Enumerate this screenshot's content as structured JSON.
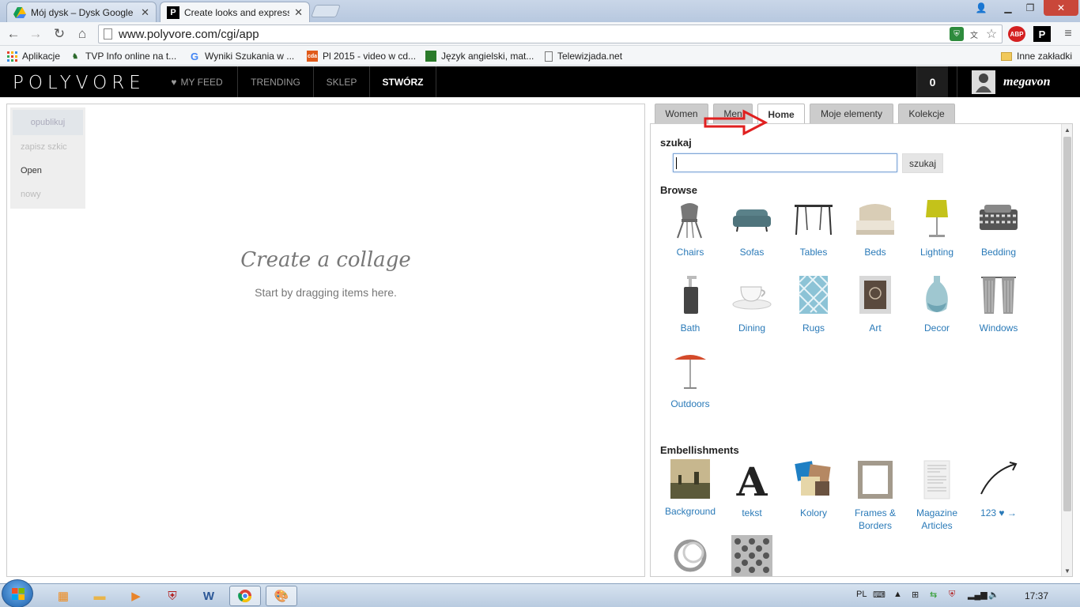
{
  "browser": {
    "tabs": [
      {
        "title": "Mój dysk – Dysk Google",
        "icon": "google-drive-icon"
      },
      {
        "title": "Create looks and express y",
        "icon": "polyvore-p-icon"
      }
    ],
    "url": "www.polyvore.com/cgi/app",
    "bookmarks": [
      {
        "label": "Aplikacje",
        "icon": "apps-grid-icon"
      },
      {
        "label": "TVP Info online na t...",
        "icon": "tvp-info-icon"
      },
      {
        "label": "Wyniki Szukania w ...",
        "icon": "google-g-icon"
      },
      {
        "label": "Pl 2015 - video w cd...",
        "icon": "cda-icon"
      },
      {
        "label": "Język angielski, mat...",
        "icon": "book-icon"
      },
      {
        "label": "Telewizjada.net",
        "icon": "page-icon"
      },
      {
        "label": "Inne zakładki",
        "icon": "folder-icon"
      }
    ],
    "ext_abp": "ABP",
    "ext_p": "P"
  },
  "polyvore": {
    "logo": "POLYVORE",
    "nav": [
      {
        "label": "MY FEED"
      },
      {
        "label": "TRENDING"
      },
      {
        "label": "SKLEP"
      },
      {
        "label": "STWÓRZ"
      }
    ],
    "notification_count": "0",
    "username": "megavon"
  },
  "canvas": {
    "menu": {
      "publish": "opublikuj",
      "save_draft": "zapisz szkic",
      "open": "Open",
      "new": "nowy"
    },
    "title": "Create a collage",
    "subtitle": "Start by dragging items here."
  },
  "panel": {
    "tabs": [
      "Women",
      "Men",
      "Home",
      "Moje elementy",
      "Kolekcje"
    ],
    "active_tab": "Home",
    "search_label": "szukaj",
    "search_value": "",
    "search_button": "szukaj",
    "browse_label": "Browse",
    "browse": [
      {
        "label": "Chairs",
        "icon": "chair-icon"
      },
      {
        "label": "Sofas",
        "icon": "sofa-icon"
      },
      {
        "label": "Tables",
        "icon": "table-icon"
      },
      {
        "label": "Beds",
        "icon": "bed-icon"
      },
      {
        "label": "Lighting",
        "icon": "lamp-icon"
      },
      {
        "label": "Bedding",
        "icon": "bedding-icon"
      },
      {
        "label": "Bath",
        "icon": "soap-dispenser-icon"
      },
      {
        "label": "Dining",
        "icon": "teacup-icon"
      },
      {
        "label": "Rugs",
        "icon": "rug-icon"
      },
      {
        "label": "Art",
        "icon": "framed-art-icon"
      },
      {
        "label": "Decor",
        "icon": "vase-icon"
      },
      {
        "label": "Windows",
        "icon": "curtain-icon"
      },
      {
        "label": "Outdoors",
        "icon": "umbrella-icon"
      }
    ],
    "embellishments_label": "Embellishments",
    "embellishments": [
      {
        "label": "Background",
        "icon": "landscape-icon"
      },
      {
        "label": "tekst",
        "icon": "letter-a-icon"
      },
      {
        "label": "Kolory",
        "icon": "color-swatch-icon"
      },
      {
        "label": "Frames & Borders",
        "icon": "frame-icon"
      },
      {
        "label": "Magazine Articles",
        "icon": "magazine-icon"
      },
      {
        "label": "123 ♥ →",
        "icon": "arrow-icon"
      },
      {
        "label": "",
        "icon": "ring-icon"
      },
      {
        "label": "",
        "icon": "pattern-icon"
      }
    ]
  },
  "taskbar": {
    "language": "PL",
    "time": "17:37"
  },
  "colors": {
    "link": "#2a7ab8",
    "header_bg": "#000000",
    "annotation_arrow": "#e02020"
  }
}
